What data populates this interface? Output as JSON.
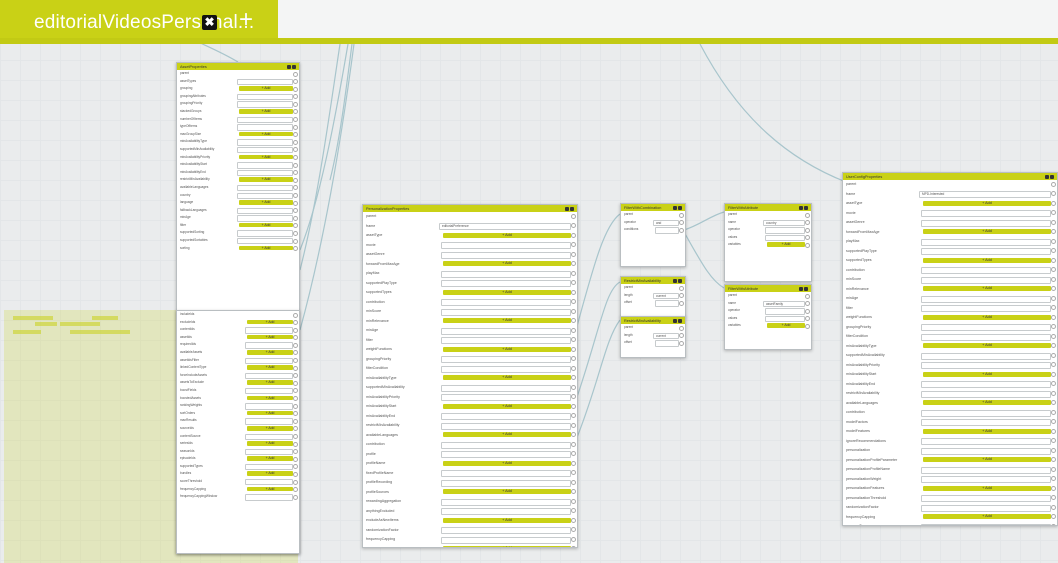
{
  "tab": {
    "label": "editorialVideosPersonal...",
    "close_glyph": "✖",
    "add_glyph": "+"
  },
  "colors": {
    "accent": "#c9d116",
    "canvas": "#eaeced",
    "wire": "#a8c5cc"
  },
  "nodes": {
    "asset_properties": {
      "title": "AssetProperties",
      "rows": [
        "parent",
        "assetTypes",
        "grouping",
        "groupingAttributes",
        "groupingPriority",
        "stackedGroups",
        "numberOfItems",
        "typeOfItems",
        "maxGroupSize",
        "minAvailabilityType",
        "supportedMinAvailability",
        "minAvailabilityPriority",
        "minAvailabilityStart",
        "minAvailabilityEnd",
        "restrictMinAvailability",
        "availableLanguages",
        "country",
        "language",
        "fallbackLanguages",
        "minAge",
        "filter",
        "supportedSorting",
        "supportedSortables",
        "sorting"
      ],
      "add_label": "+ Add"
    },
    "overlay": {
      "rows": [
        "includeIds",
        "excludeIds",
        "contentIds",
        "assetIds",
        "requiredIds",
        "availableAssets",
        "assetIdsFilter",
        "linkedContentType",
        "forceIncludeAssets",
        "assetsToExclude",
        "boostFields",
        "boostedAssets",
        "rankingWeights",
        "sortOrders",
        "maxResults",
        "sourceIds",
        "contentSource",
        "seriesIds",
        "seasonIds",
        "episodeIds",
        "supportedTypes",
        "bundles",
        "scoreThreshold",
        "frequencyCapping",
        "frequencyCappingWindow"
      ],
      "add_label": "+ Add"
    },
    "personalization": {
      "title": "PersonalizationProperties",
      "rows": [
        "parent",
        "frame",
        "assetType",
        "movie",
        "assetGenre",
        "forwardFromMaxAge",
        "playMax",
        "supportedPlayType",
        "supportedTypes",
        "contribution",
        "minScore",
        "minRelevance",
        "minAge",
        "filter",
        "weightFunctions",
        "groupingPriority",
        "filterCondition",
        "minAvailabilityType",
        "supportedMinAvailability",
        "minAvailabilityPriority",
        "minAvailabilityStart",
        "minAvailabilityEnd",
        "restrictMinAvailability",
        "availableLanguages",
        "contribution",
        "profile",
        "profileName",
        "fixedProfileName",
        "profileRecording",
        "profileSources",
        "rewardingAggregation",
        "anythingExcluded",
        "excludeAsNewItems",
        "randomizationFactor",
        "frequencyCapping",
        "programTypes"
      ],
      "frame_value": "editorialPreference",
      "add_label": "+ Add"
    },
    "filter_combination": {
      "title": "FilterWithCombination",
      "rows": [
        "parent",
        "operator",
        "conditions"
      ],
      "operator_value": "and"
    },
    "filter_attribute": {
      "title": "FilterWithAttribute",
      "rows": [
        "parent",
        "name",
        "operator",
        "values",
        "variables"
      ],
      "name_value": "country",
      "add_label": "+ Add"
    },
    "restrict_1": {
      "title": "RestrictMinAvailability",
      "rows": [
        "parent",
        "length",
        "offset"
      ],
      "select_value": "current",
      "button": "Add"
    },
    "restrict_2": {
      "title": "RestrictMinAvailability",
      "rows": [
        "parent",
        "length",
        "offset"
      ],
      "select_value": "current",
      "button": "Add"
    },
    "filter_attribute_2": {
      "title": "FilterWithAttribute",
      "rows": [
        "parent",
        "name",
        "operator",
        "values",
        "variables"
      ],
      "name_value": "assetFamily",
      "add_label": "+ Add"
    },
    "user_config": {
      "title": "UserConfigProperties",
      "rows": [
        "parent",
        "frame",
        "assetType",
        "movie",
        "assetGenre",
        "forwardFromMaxAge",
        "playMax",
        "supportedPlayType",
        "supportedTypes",
        "contribution",
        "minScore",
        "minRelevance",
        "minAge",
        "filter",
        "weightFunctions",
        "groupingPriority",
        "filterCondition",
        "minAvailabilityType",
        "supportedMinAvailability",
        "minAvailabilityPriority",
        "minAvailabilityStart",
        "minAvailabilityEnd",
        "restrictMinAvailability",
        "availableLanguages",
        "contribution",
        "modelFactors",
        "modelFeatures",
        "ignoreRecommendations",
        "personalization",
        "personalizationProfileParameter",
        "personalizationProfileName",
        "personalizationWeight",
        "personalizationFeatures",
        "personalizationThreshold",
        "randomizationFactor",
        "frequencyCapping",
        "programTypes"
      ],
      "frame_value": "MPD-Interested",
      "add_label": "+ Add"
    }
  }
}
